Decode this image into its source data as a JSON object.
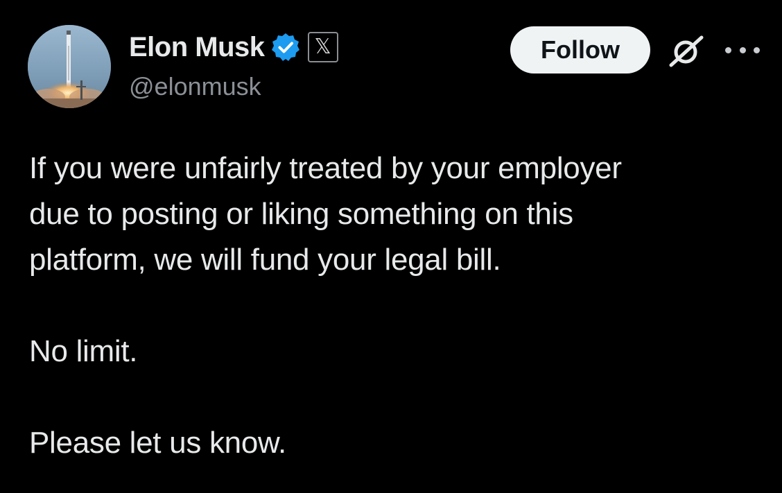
{
  "author": {
    "display_name": "Elon Musk",
    "handle": "@elonmusk",
    "verified_icon": "verified-badge-icon",
    "affiliation_icon": "x-logo-icon",
    "affiliation_glyph": "𝕏"
  },
  "actions": {
    "follow_label": "Follow",
    "grok_icon": "grok-icon",
    "more_icon": "more-options-icon"
  },
  "tweet": {
    "lines": [
      "If you were unfairly treated by your employer",
      "due to posting or liking something on this",
      "platform, we will fund your legal bill."
    ],
    "paragraph2": "No limit.",
    "paragraph3": "Please let us know."
  },
  "colors": {
    "background": "#000000",
    "text_primary": "#e7e9ea",
    "text_secondary": "#8b9096",
    "verified_blue": "#1d9bf0",
    "follow_bg": "#eff3f4",
    "follow_text": "#0f1419"
  }
}
